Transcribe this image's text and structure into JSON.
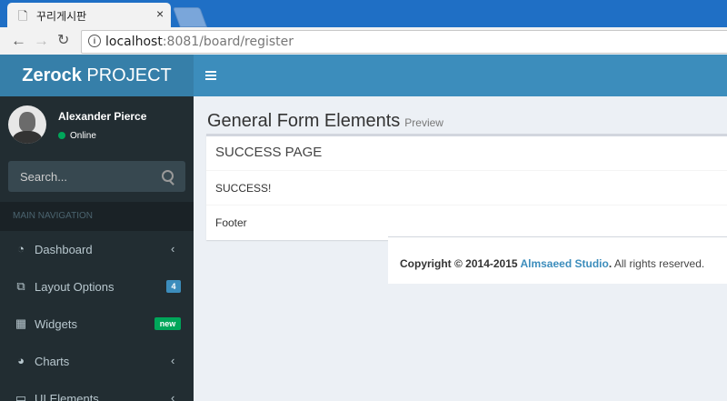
{
  "browser": {
    "tab_title": "꾸리게시판",
    "url_host": "localhost",
    "url_rest": ":8081/board/register"
  },
  "header": {
    "logo_bold": "Zerock",
    "logo_light": " PROJECT"
  },
  "sidebar": {
    "user_name": "Alexander Pierce",
    "user_status": "Online",
    "search_placeholder": "Search...",
    "section_header": "MAIN NAVIGATION",
    "items": [
      {
        "label": "Dashboard",
        "icon": "dashboard-icon"
      },
      {
        "label": "Layout Options",
        "icon": "files-icon",
        "badge": "4"
      },
      {
        "label": "Widgets",
        "icon": "th-icon",
        "badge": "new"
      },
      {
        "label": "Charts",
        "icon": "pie-chart-icon"
      },
      {
        "label": "UI Elements",
        "icon": "laptop-icon"
      }
    ]
  },
  "content": {
    "title": "General Form Elements",
    "subtitle": "Preview",
    "box_title": "SUCCESS PAGE",
    "box_body": "SUCCESS!",
    "box_footer": "Footer"
  },
  "footer": {
    "copyright": "Copyright © 2014-2015 ",
    "company": "Almsaeed Studio",
    "rights": ". All rights reserved."
  },
  "colors": {
    "topbar": "#3c8dbc",
    "logo_bg": "#367fa9",
    "sidebar_bg": "#222d32",
    "content_bg": "#ecf0f5",
    "online": "#00a65a"
  }
}
